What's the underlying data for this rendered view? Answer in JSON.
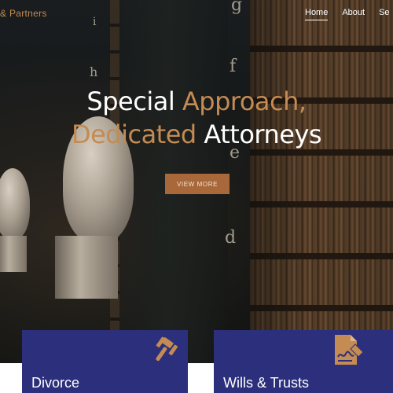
{
  "header": {
    "brand_text": "& Partners",
    "nav": [
      {
        "label": "Home",
        "active": true
      },
      {
        "label": "About",
        "active": false
      },
      {
        "label": "Se",
        "active": false
      }
    ]
  },
  "hero": {
    "headline_line1_white": "Special ",
    "headline_line1_accent": "Approach,",
    "headline_line2_accent": "Dedicated ",
    "headline_line2_white": "Attorneys",
    "cta_label": "VIEW MORE",
    "background_letters": [
      "g",
      "i",
      "f",
      "h",
      "e",
      "d"
    ]
  },
  "services": [
    {
      "title": "Divorce",
      "icon": "gavel-icon"
    },
    {
      "title": "Wills & Trusts",
      "icon": "signed-document-icon"
    }
  ],
  "colors": {
    "accent": "#c48b52",
    "button": "#a8683a",
    "card": "#2b2f7c"
  }
}
